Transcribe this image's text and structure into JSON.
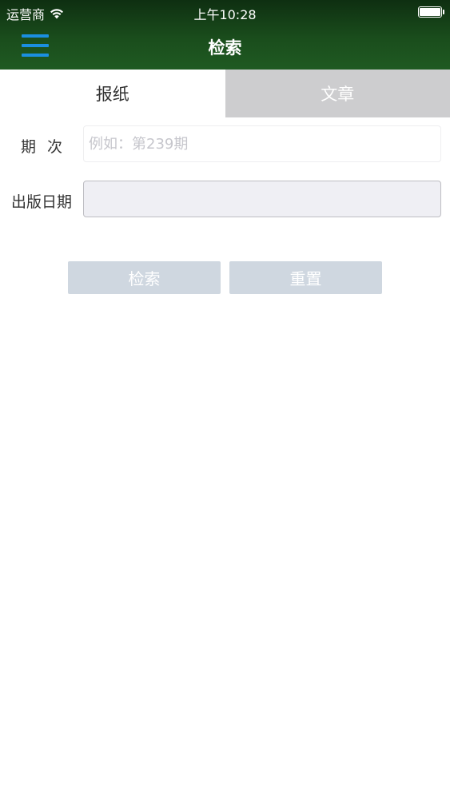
{
  "status_bar": {
    "carrier": "运营商",
    "time": "上午10:28"
  },
  "nav": {
    "title": "检索",
    "menu_icon": "hamburger-menu-icon"
  },
  "tabs": [
    {
      "label": "报纸",
      "active": true
    },
    {
      "label": "文章",
      "active": false
    }
  ],
  "form": {
    "issue_label": "期次",
    "issue_value": "",
    "issue_placeholder": "例如：第239期",
    "date_label": "出版日期",
    "date_value": ""
  },
  "buttons": {
    "search_label": "检索",
    "reset_label": "重置"
  },
  "colors": {
    "header_dark": "#0e2f11",
    "header_light": "#1f5a22",
    "menu_accent": "#1b8fe0",
    "inactive_tab": "#cdcdcf",
    "button_bg": "#cfd7e0"
  }
}
